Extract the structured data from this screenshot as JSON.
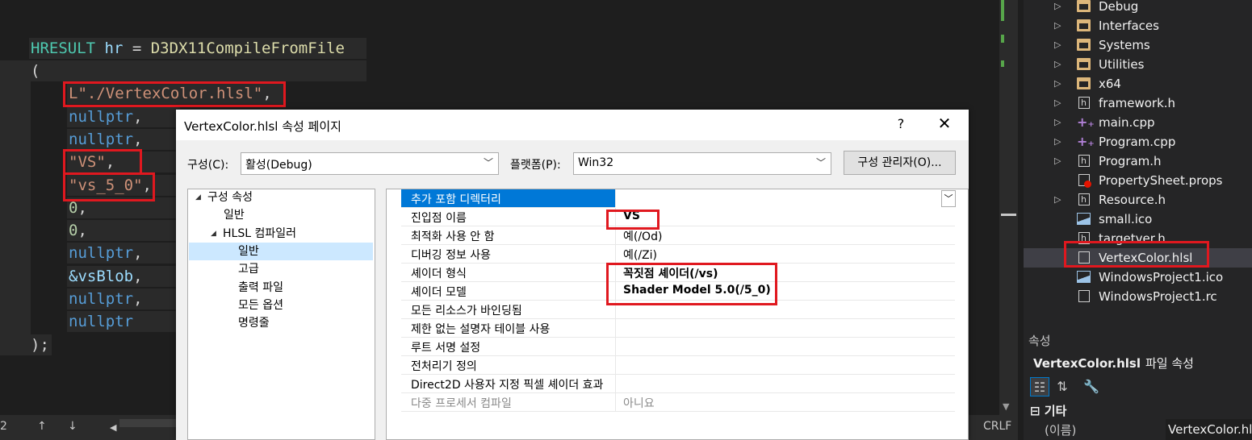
{
  "editor": {
    "lines": [
      {
        "tokens": [
          {
            "t": "HRESULT",
            "c": "tok-type"
          },
          {
            "t": " hr ",
            "c": "tok-var"
          },
          {
            "t": "= ",
            "c": "tok-op"
          },
          {
            "t": "D3DX11CompileFromFile",
            "c": "tok-fn"
          }
        ]
      },
      {
        "tokens": [
          {
            "t": "(",
            "c": "tok-op"
          }
        ]
      },
      {
        "tokens": [
          {
            "t": "L\"./VertexColor.hlsl\"",
            "c": "tok-str"
          },
          {
            "t": ",",
            "c": "tok-op"
          }
        ]
      },
      {
        "tokens": [
          {
            "t": "nullptr",
            "c": "tok-kw"
          },
          {
            "t": ",",
            "c": "tok-op"
          }
        ]
      },
      {
        "tokens": [
          {
            "t": "nullptr",
            "c": "tok-kw"
          },
          {
            "t": ",",
            "c": "tok-op"
          }
        ]
      },
      {
        "tokens": [
          {
            "t": "\"VS\"",
            "c": "tok-str"
          },
          {
            "t": ",",
            "c": "tok-op"
          }
        ]
      },
      {
        "tokens": [
          {
            "t": "\"vs_5_0\"",
            "c": "tok-str"
          },
          {
            "t": ",",
            "c": "tok-op"
          }
        ]
      },
      {
        "tokens": [
          {
            "t": "0",
            "c": "tok-num"
          },
          {
            "t": ",",
            "c": "tok-op"
          }
        ]
      },
      {
        "tokens": [
          {
            "t": "0",
            "c": "tok-num"
          },
          {
            "t": ",",
            "c": "tok-op"
          }
        ]
      },
      {
        "tokens": [
          {
            "t": "nullptr",
            "c": "tok-kw"
          },
          {
            "t": ",",
            "c": "tok-op"
          }
        ]
      },
      {
        "tokens": [
          {
            "t": "&vsBlob",
            "c": "tok-var"
          },
          {
            "t": ",",
            "c": "tok-op"
          }
        ]
      },
      {
        "tokens": [
          {
            "t": "nullptr",
            "c": "tok-kw"
          },
          {
            "t": ",",
            "c": "tok-op"
          }
        ]
      },
      {
        "tokens": [
          {
            "t": "nullptr",
            "c": "tok-kw"
          }
        ]
      },
      {
        "tokens": [
          {
            "t": ");",
            "c": "tok-op"
          }
        ]
      }
    ]
  },
  "status": {
    "line_fragment": "2",
    "up_arrow": "↑",
    "down_arrow": "↓",
    "left_arrow": "◀",
    "line_ending": "CRLF"
  },
  "solution_explorer": {
    "items": [
      {
        "label": "Debug",
        "icon": "folder-icon",
        "expandable": true
      },
      {
        "label": "Interfaces",
        "icon": "folder-icon",
        "expandable": true
      },
      {
        "label": "Systems",
        "icon": "folder-icon",
        "expandable": true
      },
      {
        "label": "Utilities",
        "icon": "folder-icon",
        "expandable": true
      },
      {
        "label": "x64",
        "icon": "folder-icon",
        "expandable": true
      },
      {
        "label": "framework.h",
        "icon": "header-file-icon",
        "expandable": true
      },
      {
        "label": "main.cpp",
        "icon": "cpp-file-icon",
        "expandable": true
      },
      {
        "label": "Program.cpp",
        "icon": "cpp-file-icon",
        "expandable": true
      },
      {
        "label": "Program.h",
        "icon": "header-file-icon",
        "expandable": true
      },
      {
        "label": "PropertySheet.props",
        "icon": "property-sheet-icon",
        "expandable": false
      },
      {
        "label": "Resource.h",
        "icon": "header-file-icon",
        "expandable": true
      },
      {
        "label": "small.ico",
        "icon": "image-file-icon",
        "expandable": false
      },
      {
        "label": "targetver.h",
        "icon": "header-file-icon",
        "expandable": false
      },
      {
        "label": "VertexColor.hlsl",
        "icon": "file-icon",
        "expandable": false,
        "selected": true
      },
      {
        "label": "WindowsProject1.ico",
        "icon": "image-file-icon",
        "expandable": false
      },
      {
        "label": "WindowsProject1.rc",
        "icon": "resource-file-icon",
        "expandable": false
      }
    ]
  },
  "properties_panel": {
    "title": "속성",
    "subject_name": "VertexColor.hlsl",
    "subject_kind": "파일 속성",
    "category": "기타",
    "row_name": "(이름)",
    "row_value": "VertexColor.hlsl",
    "tools": [
      "categorized-icon",
      "alphabetical-icon",
      "property-pages-wrench-icon"
    ]
  },
  "dialog": {
    "title": "VertexColor.hlsl 속성 페이지",
    "help": "?",
    "close": "✕",
    "config_label": "구성(C):",
    "config_value": "활성(Debug)",
    "platform_label": "플랫폼(P):",
    "platform_value": "Win32",
    "config_manager": "구성 관리자(O)...",
    "tree": [
      {
        "label": "구성 속성",
        "level": 0,
        "expander": "◢"
      },
      {
        "label": "일반",
        "level": 1
      },
      {
        "label": "HLSL 컴파일러",
        "level": 1,
        "expander": "◢"
      },
      {
        "label": "일반",
        "level": 2,
        "selected": true
      },
      {
        "label": "고급",
        "level": 2
      },
      {
        "label": "출력 파일",
        "level": 2
      },
      {
        "label": "모든 옵션",
        "level": 2
      },
      {
        "label": "명령줄",
        "level": 2
      }
    ],
    "grid": [
      {
        "name": "추가 포함 디렉터리",
        "value": "",
        "selected": true
      },
      {
        "name": "진입점 이름",
        "value": "VS",
        "bold": true
      },
      {
        "name": "최적화 사용 안 함",
        "value": "예(/Od)"
      },
      {
        "name": "디버깅 정보 사용",
        "value": "예(/Zi)"
      },
      {
        "name": "셰이더 형식",
        "value": "꼭짓점 셰이더(/vs)",
        "bold": true
      },
      {
        "name": "셰이더 모델",
        "value": "Shader Model 5.0(/5_0)",
        "bold": true
      },
      {
        "name": "모든 리소스가 바인딩됨",
        "value": ""
      },
      {
        "name": "제한 없는 설명자 테이블 사용",
        "value": ""
      },
      {
        "name": "루트 서명 설정",
        "value": ""
      },
      {
        "name": "전처리기 정의",
        "value": ""
      },
      {
        "name": "Direct2D 사용자 지정 픽셀 셰이더 효과",
        "value": ""
      },
      {
        "name": "다중 프로세서 컴파일",
        "value": "아니요",
        "dim": true
      }
    ]
  },
  "colors": {
    "highlight_box": "#e0181f",
    "accent": "#0078d7"
  }
}
